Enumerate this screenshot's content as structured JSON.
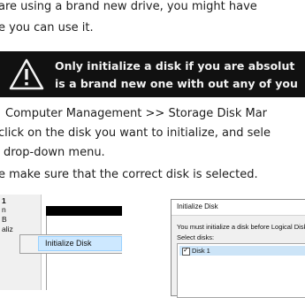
{
  "intro": {
    "line1": "are using a brand new drive, you might have",
    "line2": "e you can use it."
  },
  "warning": {
    "icon": "warning-triangle-icon",
    "line1": "Only initialize a disk if you are absolut",
    "line2": "is a brand new one with out any of you"
  },
  "steps": {
    "line1": "Computer Management >> Storage Disk Mar",
    "line2": "click on the disk you want to initialize, and sele",
    "line3": "drop-down menu.",
    "line4": "e make sure that the correct disk is selected."
  },
  "disk_management": {
    "labels": [
      "1",
      "n",
      "B",
      "aliz"
    ],
    "context_menu_item": "Initialize Disk"
  },
  "dialog": {
    "title": "Initialize Disk",
    "message": "You must initialize a disk before Logical Disk",
    "select_label": "Select disks:",
    "disk_item": "Disk 1"
  }
}
